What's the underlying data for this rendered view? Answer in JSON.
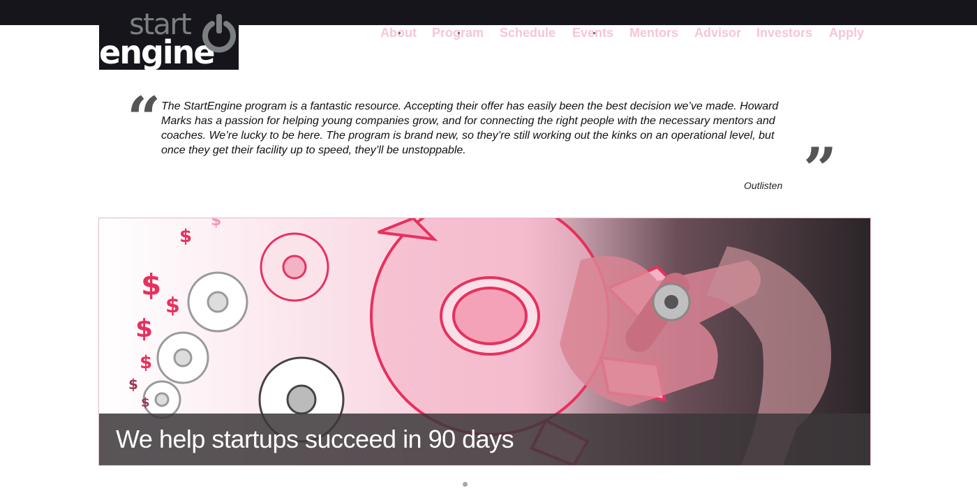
{
  "header": {
    "logo": {
      "word_top": "start",
      "word_bottom": "engine"
    },
    "nav": [
      {
        "label": "About",
        "has_submenu": true
      },
      {
        "label": "Program",
        "has_submenu": true
      },
      {
        "label": "Schedule",
        "has_submenu": false
      },
      {
        "label": "Events",
        "has_submenu": true
      },
      {
        "label": "Mentors",
        "has_submenu": false
      },
      {
        "label": "Advisor",
        "has_submenu": false
      },
      {
        "label": "Investors",
        "has_submenu": false
      },
      {
        "label": "Apply",
        "has_submenu": false
      }
    ]
  },
  "testimonial": {
    "text": "The StartEngine program is a fantastic resource. Accepting their offer has easily been the best decision we’ve made. Howard Marks has a passion for helping young companies grow, and for connecting the right people with the necessary mentors and coaches. We’re lucky to be here. The program is brand new, so they’re still working out the kinks on an operational level, but once they get their facility up to speed, they’ll be unstoppable.",
    "author": "Outlisten",
    "open_mark": "“",
    "close_mark": "”"
  },
  "slider": {
    "caption": "We help startups succeed in 90 days",
    "image_icon": "gears-hand-illustration",
    "dots": 1
  },
  "colors": {
    "topbar": "#16151c",
    "nav_text": "#f5c6d5",
    "accent_pink": "#e8305e"
  }
}
